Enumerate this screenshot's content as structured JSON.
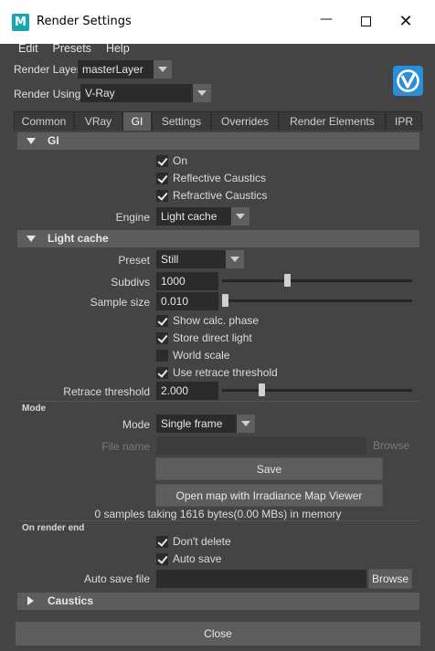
{
  "window": {
    "title": "Render Settings",
    "app_icon_letter": "M"
  },
  "menu": [
    "Edit",
    "Presets",
    "Help"
  ],
  "render_layer": {
    "label": "Render Layer",
    "value": "masterLayer"
  },
  "render_using": {
    "label": "Render Using",
    "value": "V-Ray"
  },
  "tabs": [
    "Common",
    "VRay",
    "GI",
    "Settings",
    "Overrides",
    "Render Elements",
    "IPR"
  ],
  "active_tab": "GI",
  "gi": {
    "header": "GI",
    "on": {
      "label": "On",
      "checked": true
    },
    "reflective_caustics": {
      "label": "Reflective Caustics",
      "checked": true
    },
    "refractive_caustics": {
      "label": "Refractive Caustics",
      "checked": true
    },
    "engine": {
      "label": "Engine",
      "value": "Light cache"
    }
  },
  "light_cache": {
    "header": "Light cache",
    "preset": {
      "label": "Preset",
      "value": "Still"
    },
    "subdivs": {
      "label": "Subdivs",
      "value": "1000",
      "slider_fraction": 0.34
    },
    "sample_size": {
      "label": "Sample size",
      "value": "0.010",
      "slider_fraction": 0.0
    },
    "show_calc_phase": {
      "label": "Show calc. phase",
      "checked": true
    },
    "store_direct_light": {
      "label": "Store direct light",
      "checked": true
    },
    "world_scale": {
      "label": "World scale",
      "checked": false
    },
    "use_retrace_threshold": {
      "label": "Use retrace threshold",
      "checked": true
    },
    "retrace_threshold": {
      "label": "Retrace threshold",
      "value": "2.000",
      "slider_fraction": 0.2
    }
  },
  "mode": {
    "header": "Mode",
    "mode": {
      "label": "Mode",
      "value": "Single frame"
    },
    "file_name": {
      "label": "File name",
      "value": "",
      "browse": "Browse"
    },
    "save_button": "Save",
    "open_map_button": "Open map with Irradiance Map Viewer",
    "info": "0 samples taking 1616 bytes(0.00 MBs) in memory"
  },
  "on_render_end": {
    "header": "On render end",
    "dont_delete": {
      "label": "Don't delete",
      "checked": true
    },
    "auto_save": {
      "label": "Auto save",
      "checked": true
    },
    "auto_save_file": {
      "label": "Auto save file",
      "value": "",
      "browse": "Browse"
    }
  },
  "caustics": {
    "header": "Caustics"
  },
  "close_button": "Close",
  "colors": {
    "panel_bg": "#444444",
    "header_bg": "#5d5d5d",
    "field_bg": "#2b2b2b",
    "active_tab": "#5d5d5d",
    "vray_blue": "#2a8fd6"
  }
}
